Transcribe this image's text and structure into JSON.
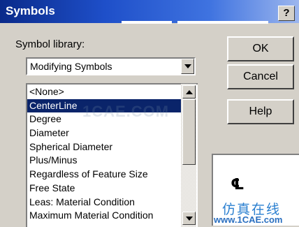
{
  "window": {
    "title": "Symbols",
    "help_glyph": "?"
  },
  "library": {
    "label": "Symbol library:",
    "selected": "Modifying Symbols"
  },
  "symbols": {
    "items": [
      "<None>",
      "CenterLine",
      "Degree",
      "Diameter",
      "Spherical Diameter",
      "Plus/Minus",
      "Regardless of Feature Size",
      "Free State",
      "Leas: Material Condition",
      "Maximum Material Condition"
    ],
    "selected_index": 1
  },
  "buttons": {
    "ok": "OK",
    "cancel": "Cancel",
    "help": "Help"
  },
  "preview": {
    "symbol": "℄"
  },
  "watermark": {
    "overlay": "1CAE.COM",
    "chinese": "仿真在线",
    "url": "www.1CAE.com"
  },
  "colors": {
    "selection": "#0a246a",
    "dialog_face": "#d4d0c8"
  }
}
